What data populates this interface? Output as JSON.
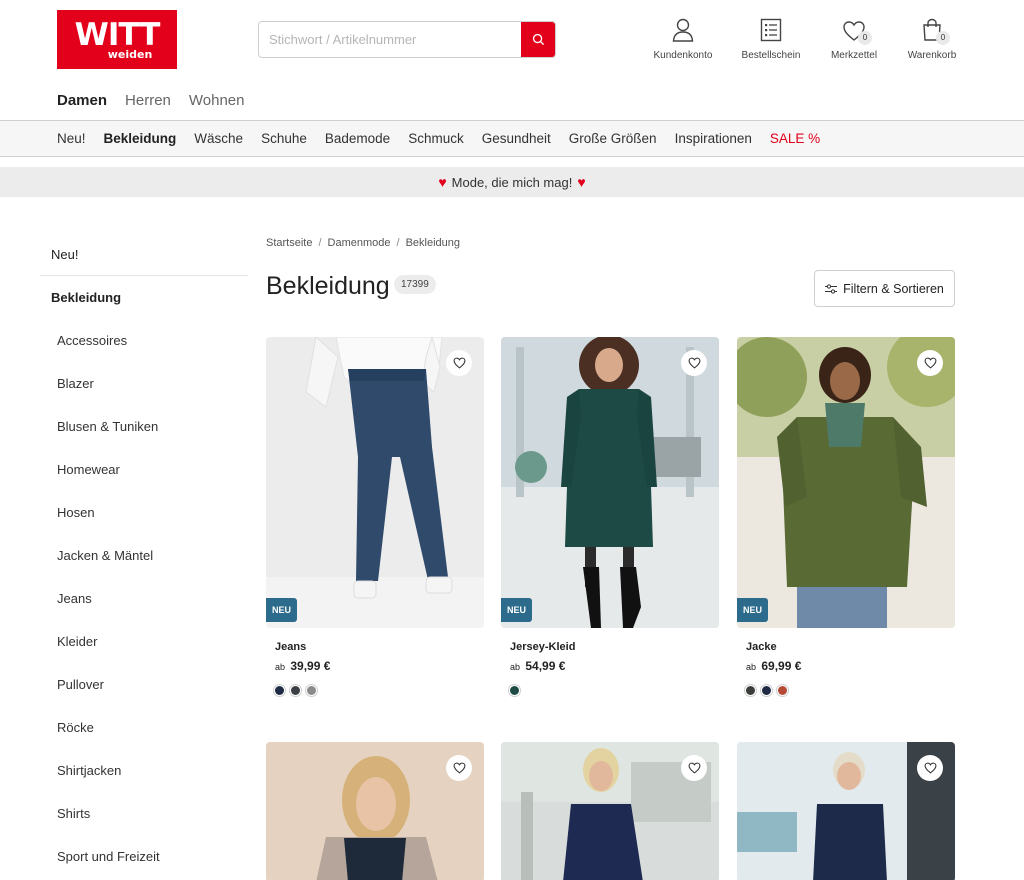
{
  "header": {
    "logo_main": "WITT",
    "logo_sub": "weiden",
    "search_placeholder": "Stichwort / Artikelnummer",
    "icons": [
      {
        "label": "Kundenkonto",
        "icon": "user-icon"
      },
      {
        "label": "Bestellschein",
        "icon": "order-form-icon"
      },
      {
        "label": "Merkzettel",
        "icon": "heart-icon",
        "badge": "0"
      },
      {
        "label": "Warenkorb",
        "icon": "shopping-bag-icon",
        "badge": "0"
      }
    ]
  },
  "gender_tabs": [
    {
      "label": "Damen",
      "active": true
    },
    {
      "label": "Herren",
      "active": false
    },
    {
      "label": "Wohnen",
      "active": false
    }
  ],
  "category_nav": [
    {
      "label": "Neu!"
    },
    {
      "label": "Bekleidung",
      "active": true
    },
    {
      "label": "Wäsche"
    },
    {
      "label": "Schuhe"
    },
    {
      "label": "Bademode"
    },
    {
      "label": "Schmuck"
    },
    {
      "label": "Gesundheit"
    },
    {
      "label": "Große Größen"
    },
    {
      "label": "Inspirationen"
    },
    {
      "label": "SALE %",
      "sale": true
    }
  ],
  "promo": {
    "text": "Mode, die mich mag!"
  },
  "sidebar": {
    "top": "Neu!",
    "current": "Bekleidung",
    "items": [
      "Accessoires",
      "Blazer",
      "Blusen & Tuniken",
      "Homewear",
      "Hosen",
      "Jacken & Mäntel",
      "Jeans",
      "Kleider",
      "Pullover",
      "Röcke",
      "Shirtjacken",
      "Shirts",
      "Sport und Freizeit"
    ]
  },
  "breadcrumb": [
    "Startseite",
    "Damenmode",
    "Bekleidung"
  ],
  "page": {
    "title": "Bekleidung",
    "count": "17399",
    "filter_label": "Filtern & Sortieren"
  },
  "products": [
    {
      "name": "Jeans",
      "price_prefix": "ab",
      "price": "39,99 €",
      "badge": "NEU",
      "swatches": [
        "#1f2a44",
        "#3b3f46",
        "#8a8a8a"
      ]
    },
    {
      "name": "Jersey-Kleid",
      "price_prefix": "ab",
      "price": "54,99 €",
      "badge": "NEU",
      "swatches": [
        "#1d4a44"
      ]
    },
    {
      "name": "Jacke",
      "price_prefix": "ab",
      "price": "69,99 €",
      "badge": "NEU",
      "swatches": [
        "#3a3d3a",
        "#1f2a44",
        "#b54a36"
      ]
    }
  ],
  "colors": {
    "brand_red": "#e2001a",
    "badge_blue": "#2d6b8c"
  }
}
